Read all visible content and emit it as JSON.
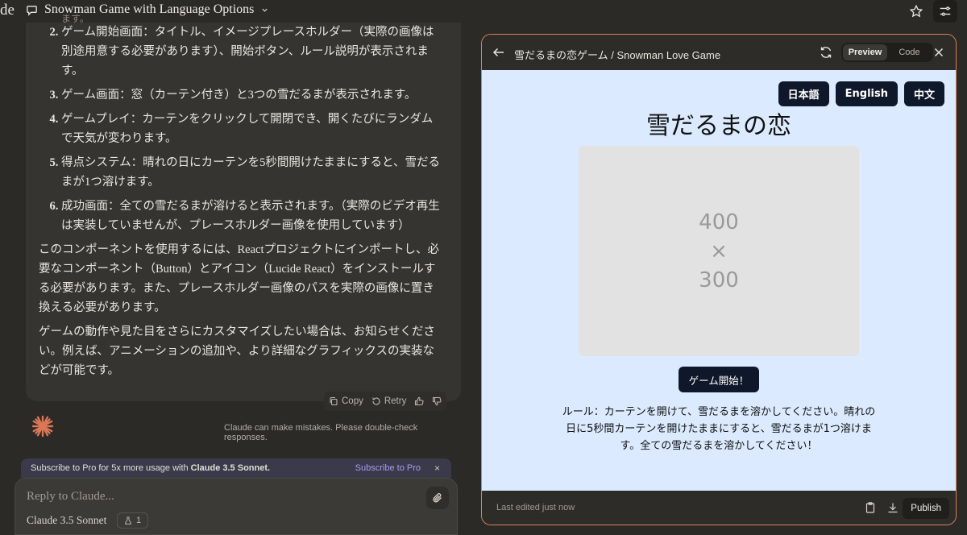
{
  "topbar": {
    "brand_fragment": "de",
    "chat_title": "Snowman Game with Language Options"
  },
  "message": {
    "items": [
      {
        "num": "2.",
        "text": "ゲーム開始画面：タイトル、イメージプレースホルダー（実際の画像は別途用意する必要があります）、開始ボタン、ルール説明が表示されます。"
      },
      {
        "num": "3.",
        "text": "ゲーム画面：窓（カーテン付き）と3つの雪だるまが表示されます。"
      },
      {
        "num": "4.",
        "text": "ゲームプレイ：カーテンをクリックして開閉でき、開くたびにランダムで天気が変わります。"
      },
      {
        "num": "5.",
        "text": "得点システム：晴れの日にカーテンを5秒間開けたままにすると、雪だるまが1つ溶けます。"
      },
      {
        "num": "6.",
        "text": "成功画面：全ての雪だるまが溶けると表示されます。（実際のビデオ再生は実装していませんが、プレースホルダー画像を使用しています）"
      }
    ],
    "para1": "このコンポーネントを使用するには、Reactプロジェクトにインポートし、必要なコンポーネント（Button）とアイコン（Lucide React）をインストールする必要があります。また、プレースホルダー画像のパスを実際の画像に置き換える必要があります。",
    "para2": "ゲームの動作や見た目をさらにカスタマイズしたい場合は、お知らせください。例えば、アニメーションの追加や、より詳細なグラフィックスの実装などが可能です。",
    "copy_label": "Copy",
    "retry_label": "Retry"
  },
  "disclaimer": "Claude can make mistakes. Please double-check responses.",
  "subscribe": {
    "text": "Subscribe to Pro for 5x more usage with",
    "model": "Claude 3.5 Sonnet.",
    "link": "Subscribe to Pro",
    "close": "×"
  },
  "reply": {
    "placeholder": "Reply to Claude...",
    "model": "Claude 3.5 Sonnet",
    "style_count": "1"
  },
  "artifact": {
    "title": "雪だるまの恋ゲーム / Snowman Love Game",
    "preview_tab": "Preview",
    "code_tab": "Code",
    "last_edited": "Last edited just now",
    "publish": "Publish",
    "game": {
      "languages": [
        "日本語",
        "English",
        "中文"
      ],
      "title": "雪だるまの恋",
      "placeholder_w": "400",
      "placeholder_x": "×",
      "placeholder_h": "300",
      "start": "ゲーム開始！",
      "rules": "ルール：カーテンを開けて、雪だるまを溶かしてください。晴れの日に5秒間カーテンを開けたままにすると、雪だるまが1つ溶けます。全ての雪だるまを溶かしてください！"
    }
  },
  "colors": {
    "accent_border": "#d9825a",
    "preview_bg": "#dbeafe",
    "button_dark": "#0f172a",
    "subscribe_link": "#a79bf0"
  }
}
